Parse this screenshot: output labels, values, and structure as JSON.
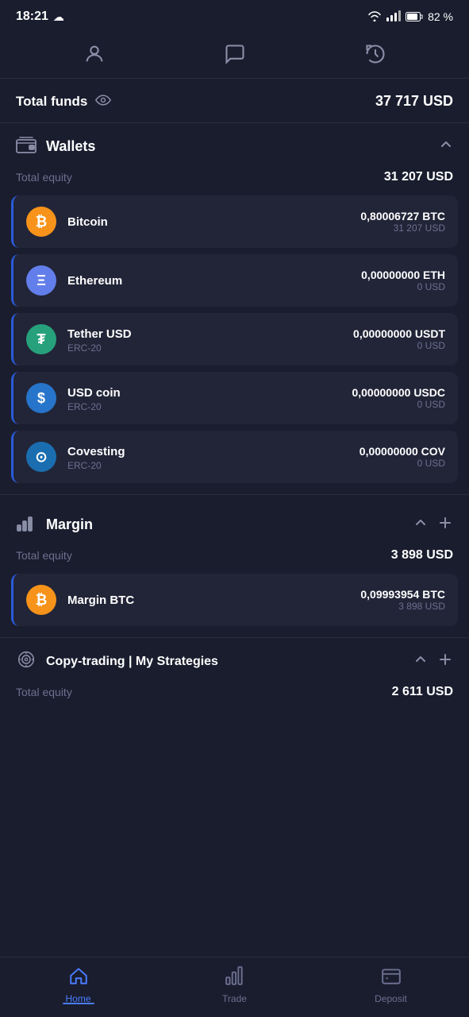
{
  "status_bar": {
    "time": "18:21",
    "battery": "82 %"
  },
  "top_nav": {
    "profile_label": "profile",
    "chat_label": "chat",
    "history_label": "history"
  },
  "total_funds": {
    "label": "Total funds",
    "amount": "37 717 USD"
  },
  "wallets": {
    "section_label": "Wallets",
    "total_equity_label": "Total equity",
    "total_equity_value": "31 207 USD",
    "items": [
      {
        "name": "Bitcoin",
        "subtitle": "",
        "crypto_amount": "0,80006727 BTC",
        "usd_amount": "31 207 USD",
        "coin_type": "btc",
        "coin_symbol": "₿"
      },
      {
        "name": "Ethereum",
        "subtitle": "",
        "crypto_amount": "0,00000000 ETH",
        "usd_amount": "0 USD",
        "coin_type": "eth",
        "coin_symbol": "Ξ"
      },
      {
        "name": "Tether USD",
        "subtitle": "ERC-20",
        "crypto_amount": "0,00000000 USDT",
        "usd_amount": "0 USD",
        "coin_type": "usdt",
        "coin_symbol": "₮"
      },
      {
        "name": "USD coin",
        "subtitle": "ERC-20",
        "crypto_amount": "0,00000000 USDC",
        "usd_amount": "0 USD",
        "coin_type": "usdc",
        "coin_symbol": "$"
      },
      {
        "name": "Covesting",
        "subtitle": "ERC-20",
        "crypto_amount": "0,00000000 COV",
        "usd_amount": "0 USD",
        "coin_type": "cov",
        "coin_symbol": "⊙"
      }
    ]
  },
  "margin": {
    "section_label": "Margin",
    "total_equity_label": "Total equity",
    "total_equity_value": "3 898 USD",
    "items": [
      {
        "name": "Margin BTC",
        "subtitle": "",
        "crypto_amount": "0,09993954 BTC",
        "usd_amount": "3 898 USD",
        "coin_type": "btc",
        "coin_symbol": "₿"
      }
    ]
  },
  "copy_trading": {
    "section_label": "Copy-trading | My Strategies",
    "total_equity_label": "Total equity",
    "total_equity_value": "2 611 USD"
  },
  "bottom_nav": {
    "home_label": "Home",
    "trade_label": "Trade",
    "deposit_label": "Deposit"
  }
}
